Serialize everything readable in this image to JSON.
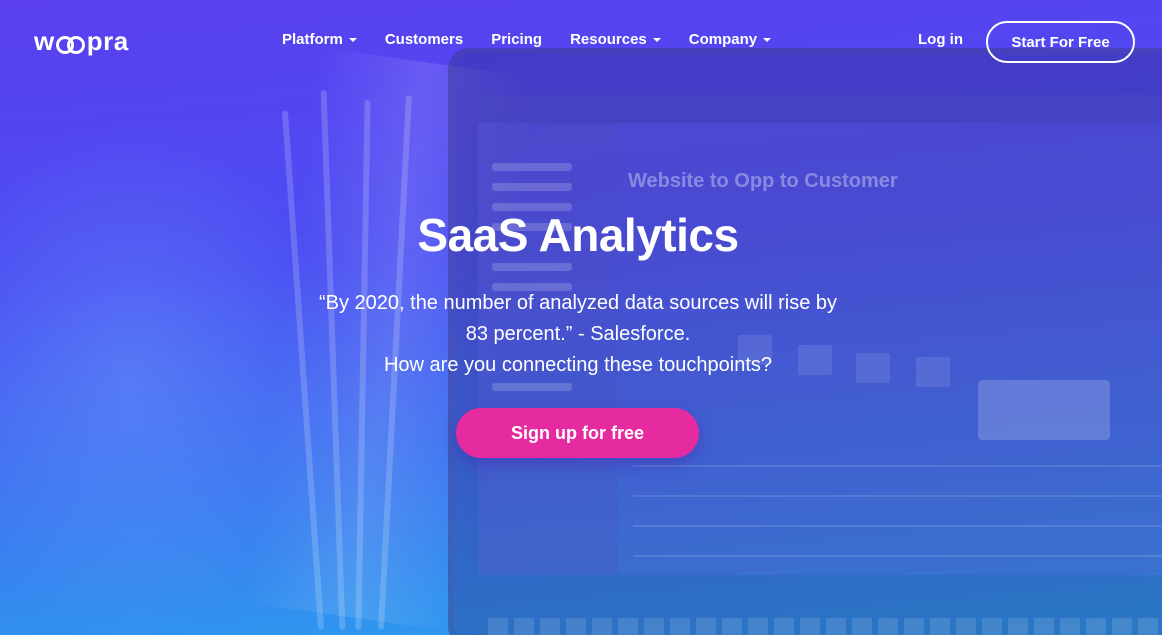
{
  "brand": {
    "logo_text_left": "w",
    "logo_text_right": "pra"
  },
  "nav": {
    "items": [
      {
        "label": "Platform",
        "dropdown": true
      },
      {
        "label": "Customers",
        "dropdown": false
      },
      {
        "label": "Pricing",
        "dropdown": false
      },
      {
        "label": "Resources",
        "dropdown": true
      },
      {
        "label": "Company",
        "dropdown": true
      }
    ],
    "login_label": "Log in",
    "start_label": "Start For Free"
  },
  "hero": {
    "title": "SaaS Analytics",
    "quote_line1": "“By 2020, the number of analyzed data sources will rise by",
    "quote_line2": "83 percent.” - Salesforce.",
    "question": "How are you connecting these touchpoints?",
    "cta_label": "Sign up for free"
  },
  "background_screen": {
    "report_title": "Website to Opp to Customer"
  },
  "colors": {
    "gradient_top": "#5a3ff0",
    "gradient_bottom": "#2aa4ee",
    "cta": "#e62ba0",
    "text": "#ffffff"
  }
}
